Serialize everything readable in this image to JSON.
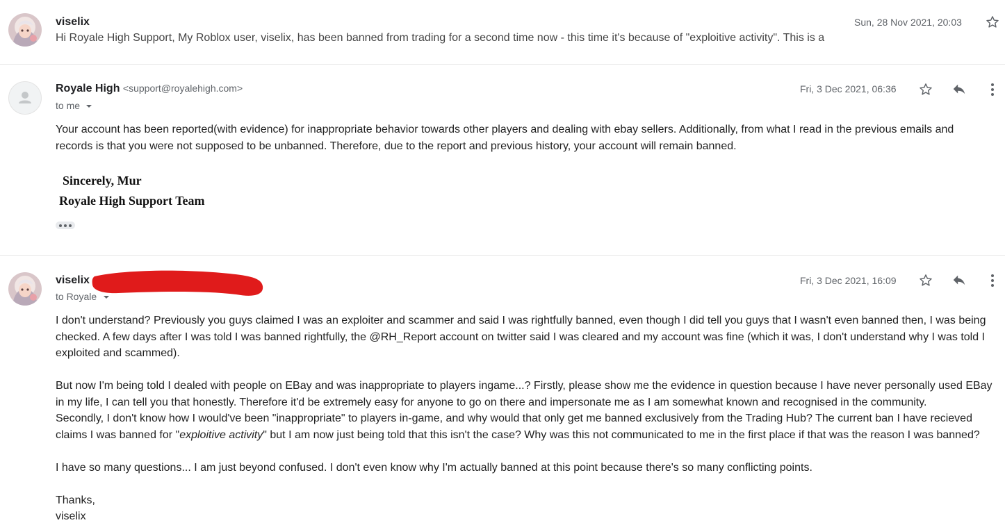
{
  "messages": [
    {
      "sender": "viselix",
      "date": "Sun, 28 Nov 2021, 20:03",
      "snippet": "Hi Royale High Support, My Roblox user, viselix, has been banned from trading for a second time now - this time it's because of \"exploitive activity\". This is a"
    },
    {
      "sender": "Royale High",
      "email": "<support@royalehigh.com>",
      "date": "Fri, 3 Dec 2021, 06:36",
      "to": "to me",
      "body": [
        "Your account has been reported(with evidence) for inappropriate behavior towards other players and dealing with ebay sellers. Additionally, from what I read in the previous emails and records is that you were not supposed to be unbanned. Therefore, due to the report and previous history, your account will remain banned."
      ],
      "signature": [
        "Sincerely, Mur",
        "Royale High Support Team"
      ]
    },
    {
      "sender": "viselix",
      "date": "Fri, 3 Dec 2021, 16:09",
      "to": "to Royale",
      "p1": "I don't understand? Previously you guys claimed I was an exploiter and scammer and said I was rightfully banned, even though I did tell you guys that I wasn't even banned then, I was being checked. A few days after I was told I was banned rightfully, the @RH_Report account on twitter said I was cleared and my account was fine (which it was, I don't understand why I was told I exploited and scammed).",
      "p2a": "But now I'm being told I dealed with people on EBay and was inappropriate to players ingame...? Firstly, please show me the evidence in question because I have never personally used EBay in my life, I can tell you that honestly. Therefore it'd be extremely easy for anyone to go on there and impersonate me as I am somewhat known and recognised in the community.",
      "p2b_pre": "Secondly, I don't know how I would've been \"inappropriate\" to players in-game, and why would that only get me banned exclusively from the Trading Hub? The current ban I have recieved claims I was banned for \"",
      "p2b_em": "exploitive activity",
      "p2b_post": "\" but I am now just being told that this isn't the case? Why was this not communicated to me in the first place if that was the reason I was banned?",
      "p3": "I have so many questions... I am just beyond confused. I don't even know why I'm actually banned at this point because there's so many conflicting points.",
      "closing": "Thanks,",
      "closing_name": "viselix"
    }
  ],
  "icons": {
    "star": "star-icon",
    "reply": "reply-icon",
    "more": "more-vert-icon",
    "caret": "caret-down-icon",
    "avatar_default": "person-icon"
  },
  "colors": {
    "redaction": "#e01b1b"
  }
}
